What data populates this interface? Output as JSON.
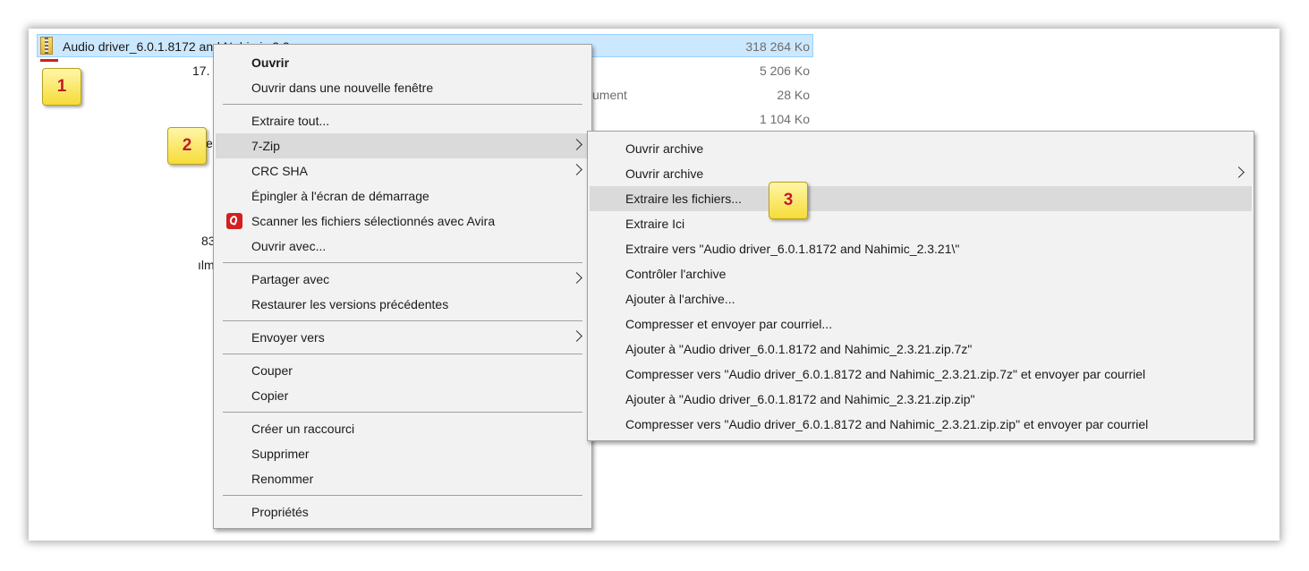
{
  "explorer": {
    "selected_file": "Audio driver_6.0.1.8172 and Nahimic 2.3...",
    "rows": [
      {
        "size": "318 264 Ko"
      },
      {
        "size": "5 206 Ko"
      },
      {
        "size": "28 Ko",
        "type_partial": "ument"
      },
      {
        "size": "1 104 Ko"
      }
    ],
    "fragments": {
      "f1": "17.",
      "f2": "et",
      "f3": "83",
      "f4": "ılm"
    }
  },
  "context_menu": {
    "items": [
      {
        "label": "Ouvrir",
        "bold": true
      },
      {
        "label": "Ouvrir dans une nouvelle fenêtre"
      },
      {
        "label": "Extraire tout..."
      },
      {
        "label": "7-Zip",
        "submenu": true,
        "highlighted": true
      },
      {
        "label": "CRC SHA",
        "submenu": true
      },
      {
        "label": "Épingler à l'écran de démarrage"
      },
      {
        "label": "Scanner les fichiers sélectionnés avec Avira",
        "icon": "avira-icon"
      },
      {
        "label": "Ouvrir avec..."
      },
      {
        "label": "Partager avec",
        "submenu": true
      },
      {
        "label": "Restaurer les versions précédentes"
      },
      {
        "label": "Envoyer vers",
        "submenu": true
      },
      {
        "label": "Couper"
      },
      {
        "label": "Copier"
      },
      {
        "label": "Créer un raccourci"
      },
      {
        "label": "Supprimer"
      },
      {
        "label": "Renommer"
      },
      {
        "label": "Propriétés"
      }
    ]
  },
  "submenu_7zip": {
    "items": [
      {
        "label": "Ouvrir archive"
      },
      {
        "label": "Ouvrir archive",
        "submenu": true
      },
      {
        "label": "Extraire les fichiers...",
        "highlighted": true
      },
      {
        "label": "Extraire Ici"
      },
      {
        "label": "Extraire vers \"Audio driver_6.0.1.8172 and Nahimic_2.3.21\\\""
      },
      {
        "label": "Contrôler l'archive"
      },
      {
        "label": "Ajouter à l'archive..."
      },
      {
        "label": "Compresser et envoyer par courriel..."
      },
      {
        "label": "Ajouter à \"Audio driver_6.0.1.8172 and Nahimic_2.3.21.zip.7z\""
      },
      {
        "label": "Compresser vers \"Audio driver_6.0.1.8172 and Nahimic_2.3.21.zip.7z\" et envoyer par courriel"
      },
      {
        "label": "Ajouter à \"Audio driver_6.0.1.8172 and Nahimic_2.3.21.zip.zip\""
      },
      {
        "label": "Compresser vers \"Audio driver_6.0.1.8172 and Nahimic_2.3.21.zip.zip\" et envoyer par courriel"
      }
    ]
  },
  "badges": {
    "b1": "1",
    "b2": "2",
    "b3": "3"
  },
  "colors": {
    "selection": "#cce8ff",
    "menu_bg": "#f2f2f2",
    "highlight": "#dadada",
    "badge_text": "#c41a1a"
  }
}
